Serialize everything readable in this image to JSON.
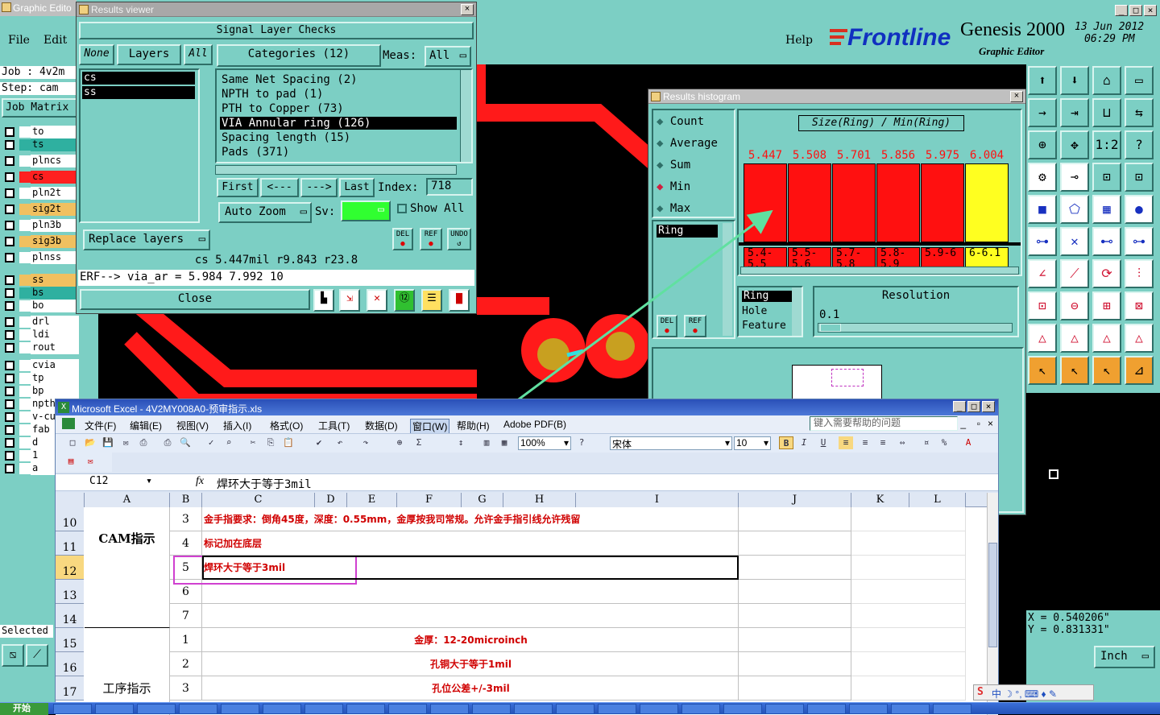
{
  "graphic_editor": {
    "title": "Graphic Edito",
    "menu": [
      "File",
      "Edit"
    ],
    "help": "Help",
    "job_label": "Job : 4v2m",
    "step_label": "Step: cam",
    "job_matrix": "Job Matrix",
    "layers": [
      {
        "name": "to",
        "color": "#ffffff"
      },
      {
        "name": "ts",
        "color": "#2fb0a0"
      },
      {
        "name": "plncs",
        "color": "#ffffff"
      },
      {
        "name": "cs",
        "color": "#ff2020"
      },
      {
        "name": "pln2t",
        "color": "#ffffff"
      },
      {
        "name": "sig2t",
        "color": "#f0c060"
      },
      {
        "name": "pln3b",
        "color": "#ffffff"
      },
      {
        "name": "sig3b",
        "color": "#f0c060"
      },
      {
        "name": "plnss",
        "color": "#ffffff"
      },
      {
        "name": "ss",
        "color": "#f0c060"
      },
      {
        "name": "bs",
        "color": "#2fb0a0"
      },
      {
        "name": "bo",
        "color": "#ffffff"
      },
      {
        "name": "drl",
        "color": "#ffffff"
      },
      {
        "name": "ldi",
        "color": "#ffffff"
      },
      {
        "name": "rout",
        "color": "#ffffff"
      },
      {
        "name": "cvia",
        "color": "#ffffff"
      },
      {
        "name": "tp",
        "color": "#ffffff"
      },
      {
        "name": "bp",
        "color": "#ffffff"
      },
      {
        "name": "npth",
        "color": "#ffffff"
      },
      {
        "name": "v-cu",
        "color": "#ffffff"
      },
      {
        "name": "fab",
        "color": "#ffffff"
      },
      {
        "name": "d",
        "color": "#ffffff"
      },
      {
        "name": "1",
        "color": "#ffffff"
      },
      {
        "name": "a",
        "color": "#ffffff"
      }
    ],
    "selected_label": "Selected",
    "brand": "Frontline",
    "product": "Genesis 2000",
    "product_sub": "Graphic Editor",
    "date": "13 Jun 2012",
    "time": "06:29 PM",
    "coord_x": "X = 0.540206\"",
    "coord_y": "Y = 0.831331\"",
    "unit": "Inch"
  },
  "results_viewer": {
    "title": "Results viewer",
    "header": "Signal Layer Checks",
    "none_btn": "None",
    "layers_btn": "Layers",
    "all_btn": "All",
    "categories_btn": "Categories (12)",
    "meas_label": "Meas:",
    "meas_value": "All",
    "layer_list": [
      "cs",
      "ss"
    ],
    "categories": [
      "Same Net Spacing (2)",
      "NPTH to pad (1)",
      "PTH to Copper (73)",
      "VIA Annular ring (126)",
      "Spacing length (15)",
      "Pads (371)"
    ],
    "selected_category_index": 3,
    "first": "First",
    "prev": "<---",
    "next": "--->",
    "last": "Last",
    "index_label": "Index:",
    "index_value": "718",
    "auto_zoom": "Auto Zoom",
    "sv_label": "Sv:",
    "show_all": "Show All",
    "replace_layers": "Replace layers",
    "del": "DEL",
    "ref": "REF",
    "undo": "UNDO",
    "status": "cs 5.447mil  r9.843  r23.8",
    "erf": "ERF--> via_ar = 5.984 7.992 10",
    "close": "Close"
  },
  "histogram": {
    "title": "Results histogram",
    "options": [
      "Count",
      "Average",
      "Sum",
      "Min",
      "Max"
    ],
    "selected_option": "Min",
    "ring_item": "Ring",
    "plot_title": "Size(Ring) / Min(Ring)",
    "bins": [
      {
        "value": "5.447",
        "range": "5.4-5.5",
        "color": "#ff1010"
      },
      {
        "value": "5.508",
        "range": "5.5-5.6",
        "color": "#ff1010"
      },
      {
        "value": "5.701",
        "range": "5.7-5.8",
        "color": "#ff1010"
      },
      {
        "value": "5.856",
        "range": "5.8-5.9",
        "color": "#ff1010"
      },
      {
        "value": "5.975",
        "range": "5.9-6",
        "color": "#ff1010"
      },
      {
        "value": "6.004",
        "range": "6-6.1",
        "color": "#ffff20"
      }
    ],
    "list_items": [
      "Ring",
      "Hole",
      "Feature"
    ],
    "resolution_label": "Resolution",
    "resolution_value": "0.1",
    "del": "DEL",
    "ref": "REF"
  },
  "excel": {
    "title": "Microsoft Excel - 4V2MY008A0-预审指示.xls",
    "menu": [
      "文件(F)",
      "编辑(E)",
      "视图(V)",
      "插入(I)",
      "格式(O)",
      "工具(T)",
      "数据(D)",
      "窗口(W)",
      "帮助(H)",
      "Adobe PDF(B)"
    ],
    "help_placeholder": "键入需要帮助的问题",
    "zoom": "100%",
    "font": "宋体",
    "font_size": "10",
    "name_box": "C12",
    "formula": "焊环大于等于3mil",
    "columns": [
      "A",
      "B",
      "C",
      "D",
      "E",
      "F",
      "G",
      "H",
      "I",
      "J",
      "K",
      "L"
    ],
    "rows": [
      {
        "num": "10",
        "b": "3",
        "c": "金手指要求：倒角45度，深度：0.55mm，金厚按我司常规。允许金手指引线允许残留"
      },
      {
        "num": "11",
        "b": "4",
        "c": "标记加在底层"
      },
      {
        "num": "12",
        "b": "5",
        "c": "焊环大于等于3mil"
      },
      {
        "num": "13",
        "b": "6",
        "c": ""
      },
      {
        "num": "14",
        "b": "7",
        "c": ""
      },
      {
        "num": "15",
        "b": "1",
        "c": "金厚：12-20microinch"
      },
      {
        "num": "16",
        "b": "2",
        "c": "孔铜大于等于1mil"
      },
      {
        "num": "17",
        "b": "3",
        "c": "孔位公差+/-3mil"
      }
    ],
    "group_a1": "CAM指示",
    "group_a2": "工序指示"
  },
  "taskbar": {
    "start": "开始"
  }
}
